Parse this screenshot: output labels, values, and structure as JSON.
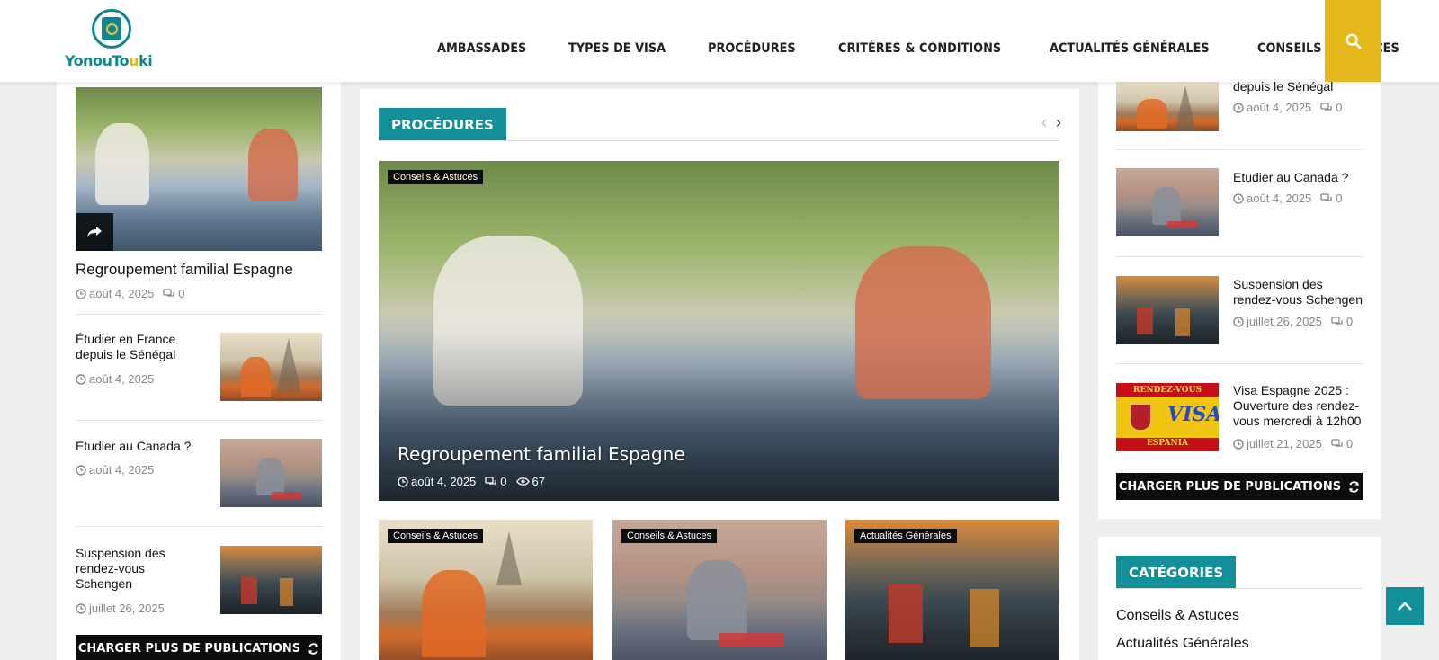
{
  "header": {
    "logo_text_a": "Yonou",
    "logo_text_b": "To",
    "logo_text_c": "u",
    "logo_text_d": "ki",
    "nav": [
      "AMBASSADES",
      "TYPES DE VISA",
      "PROCÉDURES",
      "CRITÈRES & CONDITIONS",
      "ACTUALITÉS GÉNÉRALES",
      "CONSEILS & ASTUCES"
    ]
  },
  "left": {
    "featured": {
      "title": "Regroupement familial Espagne",
      "date": "août 4, 2025",
      "comments": "0"
    },
    "items": [
      {
        "title": "Étudier en France depuis le Sénégal",
        "date": "août 4, 2025"
      },
      {
        "title": "Etudier au Canada ?",
        "date": "août 4, 2025"
      },
      {
        "title": "Suspension des rendez-vous Schengen",
        "date": "juillet 26, 2025"
      }
    ],
    "load_more": "CHARGER PLUS DE PUBLICATIONS"
  },
  "main": {
    "section_title": "PROCÉDURES",
    "hero": {
      "category": "Conseils & Astuces",
      "title": "Regroupement familial Espagne",
      "date": "août 4, 2025",
      "comments": "0",
      "views": "67"
    },
    "cards": [
      {
        "category": "Conseils & Astuces"
      },
      {
        "category": "Conseils & Astuces"
      },
      {
        "category": "Actualités Générales"
      }
    ]
  },
  "right": {
    "items": [
      {
        "title": "depuis le Sénégal",
        "date": "août 4, 2025",
        "comments": "0"
      },
      {
        "title": "Etudier au Canada ?",
        "date": "août 4, 2025",
        "comments": "0"
      },
      {
        "title": "Suspension des rendez-vous Schengen",
        "date": "juillet 26, 2025",
        "comments": "0"
      },
      {
        "title": "Visa Espagne 2025 : Ouverture des rendez-vous mercredi à 12h00",
        "date": "juillet 21, 2025",
        "comments": "0"
      }
    ],
    "spain_img": {
      "top": "RENDEZ-VOUS",
      "mid": "VISA",
      "bottom": "ESPANIA"
    },
    "load_more": "CHARGER PLUS DE PUBLICATIONS",
    "categories_title": "CATÉGORIES",
    "categories": [
      "Conseils & Astuces",
      "Actualités Générales"
    ]
  }
}
